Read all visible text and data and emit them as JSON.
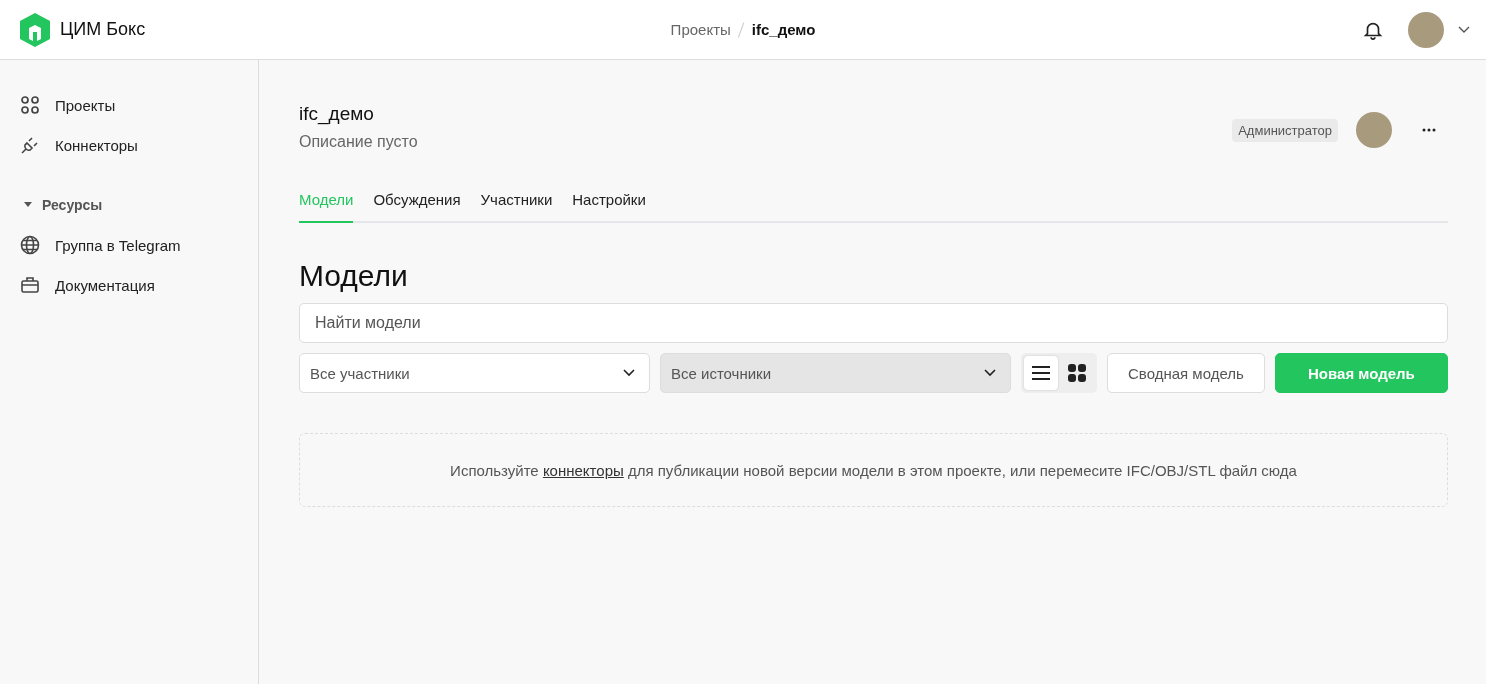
{
  "header": {
    "brand": "ЦИМ Бокс",
    "breadcrumbs": [
      {
        "label": "Проекты",
        "current": false
      },
      {
        "label": "ifc_демо",
        "current": true
      }
    ]
  },
  "sidebar": {
    "items": [
      {
        "label": "Проекты"
      },
      {
        "label": "Коннекторы"
      }
    ],
    "section": {
      "label": "Ресурсы",
      "expanded": true,
      "items": [
        {
          "label": "Группа в Telegram"
        },
        {
          "label": "Документация"
        }
      ]
    }
  },
  "project": {
    "title": "ifc_демо",
    "description": "Описание пусто",
    "role": "Администратор"
  },
  "tabs": [
    {
      "label": "Модели",
      "selected": true
    },
    {
      "label": "Обсуждения",
      "selected": false
    },
    {
      "label": "Участники",
      "selected": false
    },
    {
      "label": "Настройки",
      "selected": false
    }
  ],
  "heading": "Модели",
  "search": {
    "placeholder": "Найти модели"
  },
  "filters": [
    {
      "value": "Все участники",
      "disabled": false
    },
    {
      "value": "Все источники",
      "disabled": true
    }
  ],
  "view_toggle": [
    {
      "kind": "list",
      "selected": true
    },
    {
      "kind": "grid",
      "selected": false
    }
  ],
  "buttons": [
    {
      "label": "Сводная модель",
      "kind": "secondary"
    },
    {
      "label": "Новая модель",
      "kind": "primary"
    }
  ],
  "dropzone": {
    "before": "Используйте",
    "link": "коннекторы",
    "after": "для публикации новой версии модели в этом проекте, или перемесите IFC/OBJ/STL файл сюда"
  }
}
